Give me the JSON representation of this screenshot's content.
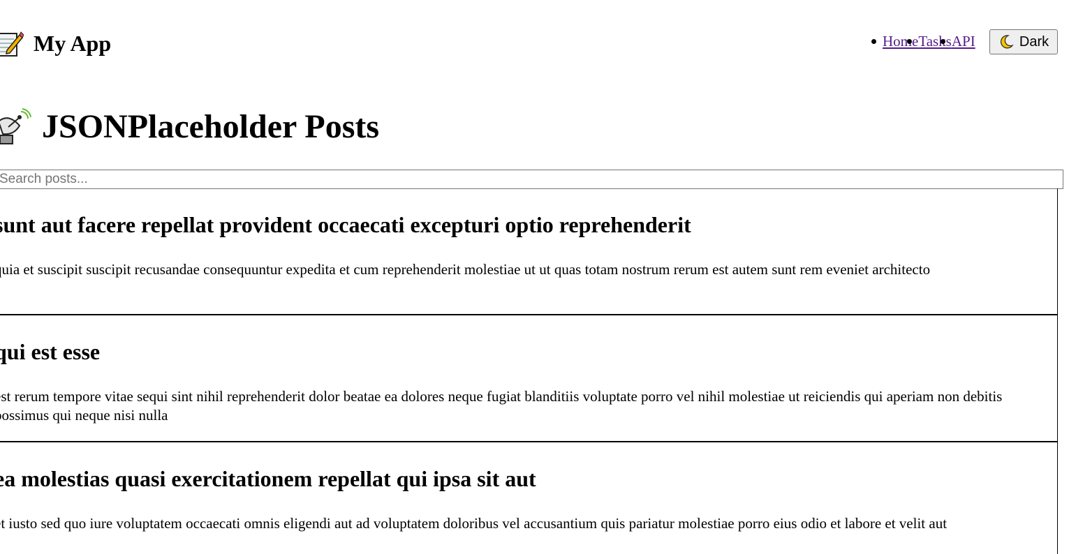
{
  "header": {
    "app_title": "My App",
    "app_icon": "memo-icon",
    "nav": [
      {
        "label": "Home"
      },
      {
        "label": "Tasks"
      },
      {
        "label": "API"
      }
    ],
    "theme_toggle": {
      "label": "Dark",
      "icon": "moon-icon"
    }
  },
  "main": {
    "page_title": "JSONPlaceholder Posts",
    "page_icon": "satellite-icon",
    "search": {
      "placeholder": "Search posts...",
      "value": ""
    },
    "posts": [
      {
        "title": "sunt aut facere repellat provident occaecati excepturi optio reprehenderit",
        "body": "quia et suscipit suscipit recusandae consequuntur expedita et cum reprehenderit molestiae ut ut quas totam nostrum rerum est autem sunt rem eveniet architecto"
      },
      {
        "title": "qui est esse",
        "body": "est rerum tempore vitae sequi sint nihil reprehenderit dolor beatae ea dolores neque fugiat blanditiis voluptate porro vel nihil molestiae ut reiciendis qui aperiam non debitis possimus qui neque nisi nulla"
      },
      {
        "title": "ea molestias quasi exercitationem repellat qui ipsa sit aut",
        "body": "et iusto sed quo iure voluptatem occaecati omnis eligendi aut ad voluptatem doloribus vel accusantium quis pariatur molestiae porro eius odio et labore et velit aut"
      }
    ]
  },
  "colors": {
    "link": "#551a8b",
    "button_bg": "#efefef",
    "button_border": "#767676",
    "divider": "#000000"
  }
}
